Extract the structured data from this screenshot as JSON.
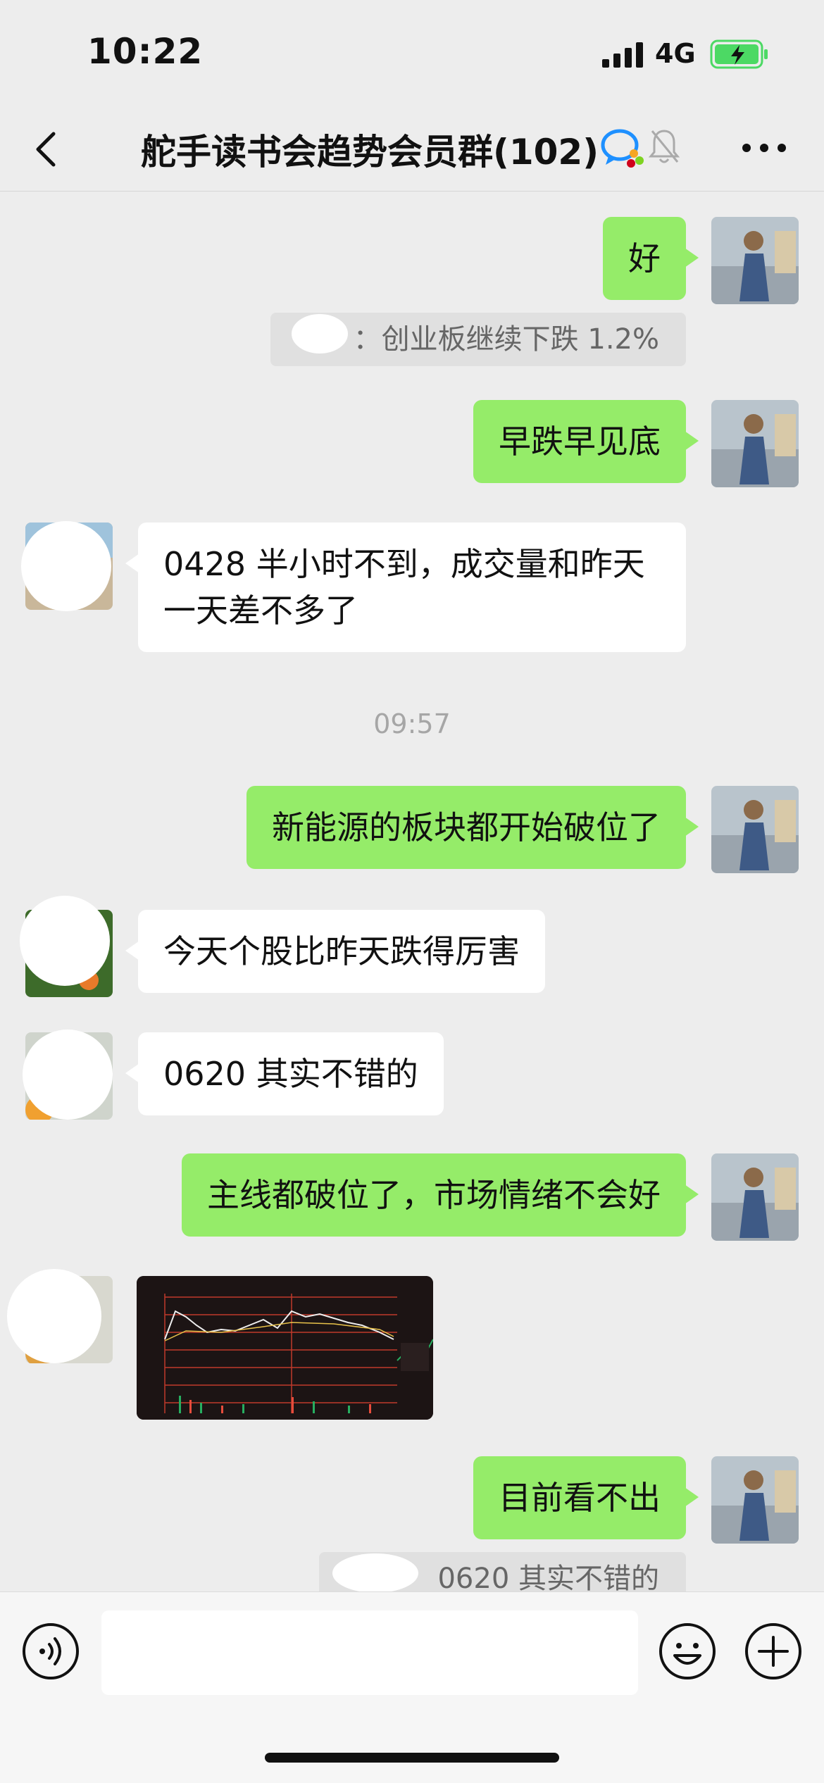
{
  "status": {
    "time": "10:22",
    "network": "4G",
    "battery_color": "#4cd964"
  },
  "header": {
    "title": "舵手读书会趋势会员群(102)"
  },
  "messages": [
    {
      "text": "好"
    },
    {
      "quote": "：创业板继续下跌 1.2%"
    },
    {
      "text": "早跌早见底"
    },
    {
      "text": "0428 半小时不到，成交量和昨天一天差不多了"
    },
    {
      "time": "09:57"
    },
    {
      "text": "新能源的板块都开始破位了"
    },
    {
      "text": "今天个股比昨天跌得厉害"
    },
    {
      "text": "0620 其实不错的"
    },
    {
      "text": "主线都破位了，市场情绪不会好"
    },
    {
      "text": "目前看不出"
    },
    {
      "quote": "0620 其实不错的"
    }
  ],
  "colors": {
    "out_bubble": "#95ec69",
    "in_bubble": "#ffffff",
    "background": "#ededed"
  }
}
